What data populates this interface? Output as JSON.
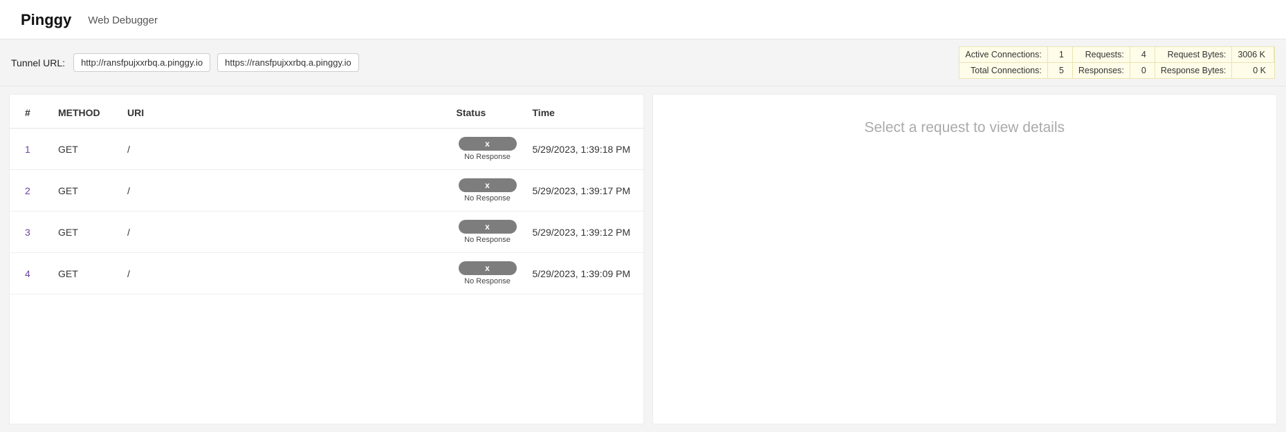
{
  "header": {
    "brand": "Pinggy",
    "subtitle": "Web Debugger"
  },
  "toolbar": {
    "tunnel_label": "Tunnel URL:",
    "http_url": "http://ransfpujxxrbq.a.pinggy.io",
    "https_url": "https://ransfpujxxrbq.a.pinggy.io"
  },
  "stats": {
    "active_connections_label": "Active Connections:",
    "active_connections": "1",
    "requests_label": "Requests:",
    "requests": "4",
    "request_bytes_label": "Request Bytes:",
    "request_bytes": "3006 K",
    "total_connections_label": "Total Connections:",
    "total_connections": "5",
    "responses_label": "Responses:",
    "responses": "0",
    "response_bytes_label": "Response Bytes:",
    "response_bytes": "0 K"
  },
  "table": {
    "headers": {
      "idx": "#",
      "method": "METHOD",
      "uri": "URI",
      "status": "Status",
      "time": "Time"
    },
    "rows": [
      {
        "idx": "1",
        "method": "GET",
        "uri": "/",
        "status_code": "x",
        "status_text": "No Response",
        "time": "5/29/2023, 1:39:18 PM"
      },
      {
        "idx": "2",
        "method": "GET",
        "uri": "/",
        "status_code": "x",
        "status_text": "No Response",
        "time": "5/29/2023, 1:39:17 PM"
      },
      {
        "idx": "3",
        "method": "GET",
        "uri": "/",
        "status_code": "x",
        "status_text": "No Response",
        "time": "5/29/2023, 1:39:12 PM"
      },
      {
        "idx": "4",
        "method": "GET",
        "uri": "/",
        "status_code": "x",
        "status_text": "No Response",
        "time": "5/29/2023, 1:39:09 PM"
      }
    ]
  },
  "details": {
    "placeholder": "Select a request to view details"
  }
}
